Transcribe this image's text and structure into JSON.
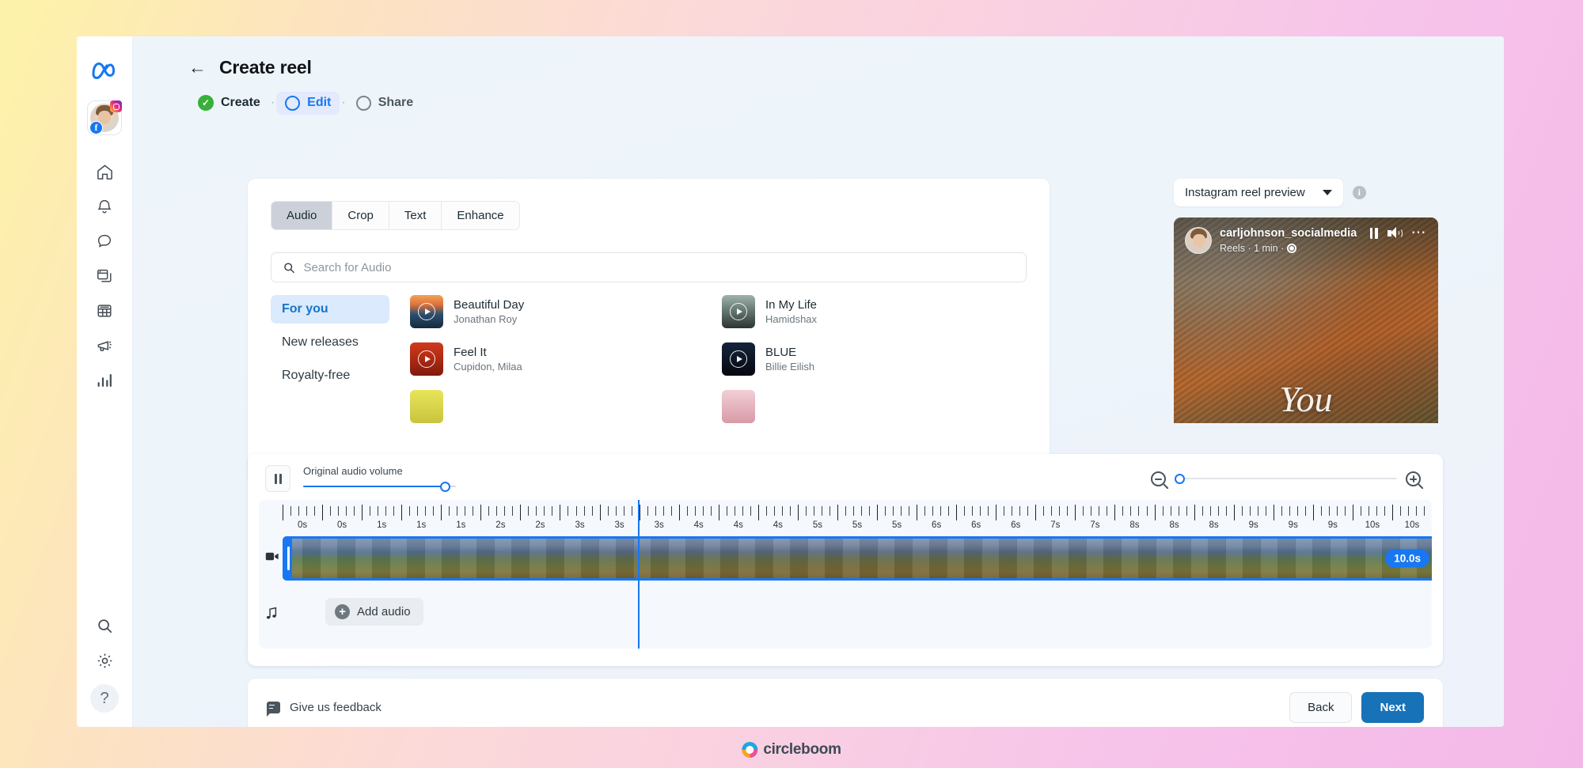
{
  "header": {
    "back_icon": "back-arrow-icon",
    "title": "Create reel",
    "steps": [
      {
        "label": "Create",
        "state": "done"
      },
      {
        "label": "Edit",
        "state": "active"
      },
      {
        "label": "Share",
        "state": "pending"
      }
    ],
    "separator": "·"
  },
  "sidebar": {
    "brand_icon": "meta-logo-icon",
    "avatar": {
      "name": "avatar",
      "badges": [
        "instagram-badge",
        "facebook-badge"
      ]
    },
    "items": [
      {
        "icon": "home-icon"
      },
      {
        "icon": "bell-icon"
      },
      {
        "icon": "chat-bubble-icon"
      },
      {
        "icon": "windows-stack-icon"
      },
      {
        "icon": "table-grid-icon"
      },
      {
        "icon": "megaphone-icon"
      },
      {
        "icon": "bar-chart-icon"
      }
    ],
    "bottom_items": [
      {
        "icon": "search-icon"
      },
      {
        "icon": "gear-icon"
      },
      {
        "icon": "help-icon",
        "label": "?"
      }
    ]
  },
  "editor": {
    "tabs": [
      {
        "label": "Audio",
        "active": true
      },
      {
        "label": "Crop",
        "active": false
      },
      {
        "label": "Text",
        "active": false
      },
      {
        "label": "Enhance",
        "active": false
      }
    ],
    "search": {
      "placeholder": "Search for Audio",
      "value": "",
      "icon": "search-icon"
    },
    "categories": [
      {
        "label": "For you",
        "active": true
      },
      {
        "label": "New releases",
        "active": false
      },
      {
        "label": "Royalty-free",
        "active": false
      }
    ],
    "tracks": [
      {
        "name": "Beautiful Day",
        "artist": "Jonathan Roy",
        "thumb": "th-beautiful"
      },
      {
        "name": "In My Life",
        "artist": "Hamidshax",
        "thumb": "th-inmylife"
      },
      {
        "name": "Feel It",
        "artist": "Cupidon, Milaa",
        "thumb": "th-feelit"
      },
      {
        "name": "BLUE",
        "artist": "Billie Eilish",
        "thumb": "th-blue"
      }
    ]
  },
  "preview": {
    "select_label": "Instagram reel preview",
    "caret_icon": "chevron-down-icon",
    "info_icon": "info-icon",
    "username": "carljohnson_socialmedia",
    "meta": "Reels · 1 min ·",
    "globe_icon": "globe-icon",
    "controls": [
      "pause-icon",
      "volume-icon",
      "more-options-icon"
    ],
    "overlay_word": "You"
  },
  "timeline": {
    "pause_icon": "pause-icon",
    "volume_label": "Original audio volume",
    "volume_percent": 93,
    "zoom_out_icon": "zoom-out-icon",
    "zoom_in_icon": "zoom-in-icon",
    "zoom_percent": 0,
    "ruler_labels": [
      "0s",
      "0s",
      "1s",
      "1s",
      "1s",
      "2s",
      "2s",
      "3s",
      "3s",
      "3s",
      "4s",
      "4s",
      "4s",
      "5s",
      "5s",
      "5s",
      "6s",
      "6s",
      "6s",
      "7s",
      "7s",
      "8s",
      "8s",
      "8s",
      "9s",
      "9s",
      "9s",
      "10s",
      "10s"
    ],
    "video_icon": "video-camera-icon",
    "music_icon": "music-note-icon",
    "clip_duration": "10.0s",
    "add_audio_label": "Add audio",
    "add_audio_icon": "plus-circle-icon",
    "playhead_position_s": 3.0
  },
  "footer": {
    "feedback_label": "Give us feedback",
    "feedback_icon": "feedback-bubble-icon",
    "back_label": "Back",
    "next_label": "Next"
  },
  "watermark": {
    "text": "circleboom",
    "icon": "circleboom-logo-icon"
  },
  "colors": {
    "accent_blue": "#1877f2",
    "next_button": "#1872b8",
    "step_done_green": "#38b03a",
    "active_cat_bg": "#dbeafc"
  }
}
